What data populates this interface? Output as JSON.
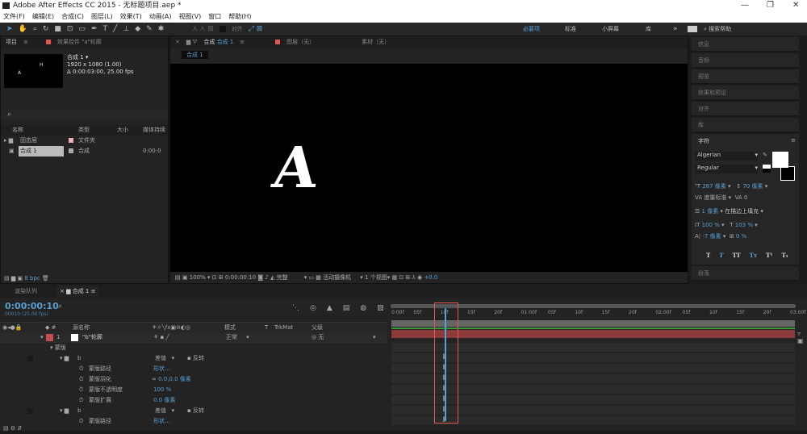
{
  "window": {
    "title": "Adobe After Effects CC 2015 - 无标题项目.aep *",
    "minimize": "—",
    "maximize": "❐",
    "close": "✕"
  },
  "menu": [
    "文件(F)",
    "编辑(E)",
    "合成(C)",
    "图层(L)",
    "效果(T)",
    "动画(A)",
    "视图(V)",
    "窗口",
    "帮助(H)"
  ],
  "toolbar": {
    "tools": [
      "selection-tool",
      "hand-tool",
      "zoom-tool",
      "rotate-tool",
      "camera-tool",
      "pan-behind-tool",
      "rectangle-tool",
      "pen-tool",
      "text-tool",
      "brush-tool",
      "clone-stamp-tool",
      "eraser-tool",
      "roto-brush-tool",
      "puppet-tool"
    ],
    "align_label": "对齐",
    "workspaces": [
      "必要项",
      "标准",
      "小屏幕",
      "库"
    ],
    "active_workspace": "必要项",
    "search_help": "搜索帮助"
  },
  "project": {
    "tab": "项目",
    "effects_tab": "效果控件 \"a\"轮廓",
    "comp_name": "合成 1 ▾",
    "comp_size": "1920 x 1080 (1.00)",
    "comp_duration": "Δ 0:00:03:00, 25.00 fps",
    "columns": [
      "名称",
      "类型",
      "大小",
      "媒体持续"
    ],
    "items": [
      {
        "name": "固态层",
        "type": "文件夹",
        "duration": ""
      },
      {
        "name": "合成 1",
        "type": "合成",
        "duration": "0:00:0"
      }
    ],
    "bpc": "8 bpc"
  },
  "viewer": {
    "tab": "合成",
    "tab_comp": "合成 1",
    "layer_tab": "图层（无）",
    "footage_tab": "素材（无）",
    "comp_chip": "合成 1",
    "glyph": "A",
    "zoom": "100%",
    "timecode": "0:00:00:10",
    "resolution": "完整",
    "camera": "活动摄像机",
    "views": "1 个视图",
    "exposure": "+0.0"
  },
  "right_panels": [
    "信息",
    "音频",
    "预览",
    "效果和预设",
    "对齐",
    "库"
  ],
  "character": {
    "title": "字符",
    "font": "Algerian",
    "style": "Regular",
    "size": "287 像素",
    "leading": "70 像素",
    "kerning": "度量标准",
    "tracking": "0",
    "stroke_width": "1 像素",
    "stroke_mode": "在描边上填充",
    "vscale": "100 %",
    "hscale": "103 %",
    "baseline": "-7 像素",
    "tsume": "0 %",
    "fill_color": "#ffffff",
    "stroke_color": "#000000",
    "styles": [
      "T",
      "T",
      "TT",
      "Tт",
      "T¹",
      "T₁"
    ]
  },
  "paragraph": "段落",
  "timeline": {
    "render_tab": "渲染队列",
    "comp_tab": "合成 1",
    "timecode": "0:00:00:10",
    "frame_info": "00010 (25.00 fps)",
    "columns": {
      "layer_name": "源名称",
      "mode": "模式",
      "t": "T",
      "trkmat": "TrkMat",
      "parent": "父级"
    },
    "layer": {
      "num": "1",
      "name": "\"b\"轮廓",
      "mode": "正常",
      "parent": "无",
      "color": "#c0504d"
    },
    "masks_group": "蒙版",
    "masks": [
      {
        "name": "b",
        "mode": "差值",
        "invert": "反转",
        "props": [
          {
            "name": "蒙版路径",
            "value": "形状..."
          },
          {
            "name": "蒙版羽化",
            "value": "0.0,0.0 像素"
          },
          {
            "name": "蒙版不透明度",
            "value": "100 %"
          },
          {
            "name": "蒙版扩展",
            "value": "0.0 像素"
          }
        ]
      },
      {
        "name": "b",
        "mode": "差值",
        "invert": "反转",
        "props": [
          {
            "name": "蒙版路径",
            "value": "形状..."
          }
        ]
      }
    ],
    "ruler": [
      "0:00f",
      "05f",
      "10f",
      "15f",
      "20f",
      "01:00f",
      "05f",
      "10f",
      "15f",
      "20f",
      "02:00f",
      "05f",
      "10f",
      "15f",
      "20f",
      "03:00f"
    ],
    "current_frame": 10,
    "total_frames": 75,
    "accent": "#5a9fd4",
    "highlight": "#e05a5a"
  }
}
